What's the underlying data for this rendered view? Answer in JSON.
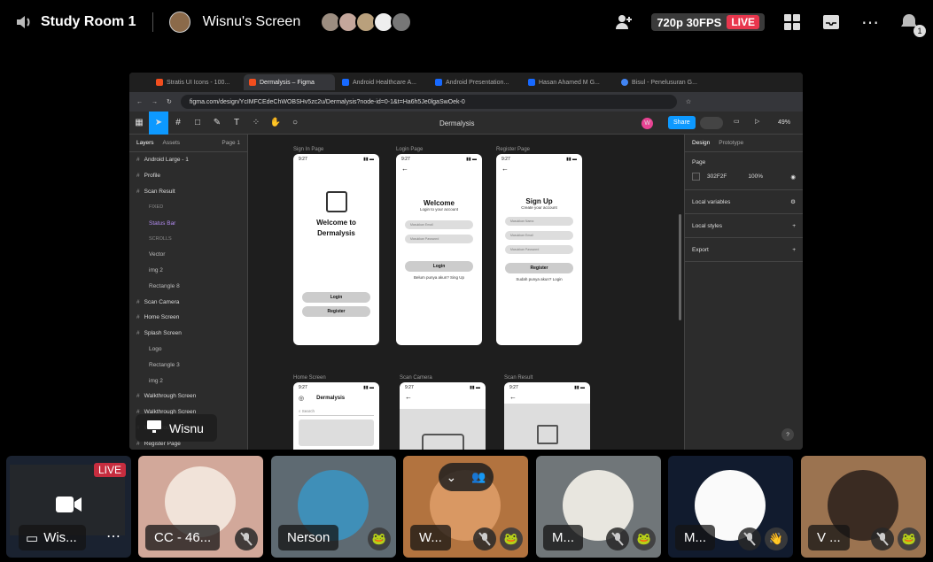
{
  "topbar": {
    "room_title": "Study Room 1",
    "screen_owner": "Wisnu's Screen",
    "quality": "720p 30FPS",
    "live": "LIVE",
    "notification_count": "1"
  },
  "browser": {
    "tabs": [
      {
        "label": "Stratis UI Icons - 100...",
        "color": "#f24e1e"
      },
      {
        "label": "Dermalysis – Figma",
        "color": "#f24e1e"
      },
      {
        "label": "Android Healthcare A...",
        "color": "#1769ff"
      },
      {
        "label": "Android Presentation...",
        "color": "#1769ff"
      },
      {
        "label": "Hasan Ahamed M G...",
        "color": "#1769ff"
      },
      {
        "label": "Bisul - Penelusuran G...",
        "color": "#4285f4"
      }
    ],
    "url": "figma.com/design/YcIMFCEdeChWOBSHv5zc2u/Dermalysis?node-id=0-1&t=Ha6h5Je0lgaSwOek-0"
  },
  "figma": {
    "doc_title": "Dermalysis",
    "share_label": "Share",
    "user_initial": "W",
    "zoom": "49%",
    "layers_tab": "Layers",
    "assets_tab": "Assets",
    "page_label": "Page 1",
    "layers": [
      {
        "label": "Android Large - 1",
        "kind": "frame"
      },
      {
        "label": "Profile",
        "kind": "frame"
      },
      {
        "label": "Scan Result",
        "kind": "frame"
      },
      {
        "label": "FIXED",
        "kind": "head"
      },
      {
        "label": "Status Bar",
        "kind": "purple"
      },
      {
        "label": "SCROLLS",
        "kind": "head"
      },
      {
        "label": "Vector",
        "kind": "sub"
      },
      {
        "label": "img 2",
        "kind": "sub"
      },
      {
        "label": "Rectangle 8",
        "kind": "sub"
      },
      {
        "label": "Scan Camera",
        "kind": "frame"
      },
      {
        "label": "Home Screen",
        "kind": "frame"
      },
      {
        "label": "Splash Screen",
        "kind": "frame"
      },
      {
        "label": "Logo",
        "kind": "sub"
      },
      {
        "label": "Rectangle 3",
        "kind": "sub"
      },
      {
        "label": "img 2",
        "kind": "sub"
      },
      {
        "label": "Walkthrough Screen",
        "kind": "frame"
      },
      {
        "label": "Walkthrough Screen",
        "kind": "frame"
      },
      {
        "label": "Walkthrough Screen",
        "kind": "frame"
      },
      {
        "label": "Register Page",
        "kind": "frame"
      }
    ],
    "right_panel": {
      "design_tab": "Design",
      "prototype_tab": "Prototype",
      "page_heading": "Page",
      "fill_hex": "302F2F",
      "fill_opacity": "100%",
      "local_variables": "Local variables",
      "local_styles": "Local styles",
      "export": "Export",
      "help": "?"
    },
    "frames": {
      "signin": {
        "label": "Sign In Page",
        "time": "9:27",
        "title": "Welcome to Dermalysis",
        "login": "Login",
        "register": "Register"
      },
      "login": {
        "label": "Login Page",
        "time": "9:27",
        "title": "Welcome",
        "subtitle": "Login to your account",
        "email_ph": "Masukkan Email",
        "password_ph": "Masukkan Password",
        "button": "Login",
        "footer": "Belum punya akun? Sing Up"
      },
      "register": {
        "label": "Register Page",
        "time": "9:27",
        "title": "Sign Up",
        "subtitle": "Create your account",
        "name_ph": "Masukkan Nama",
        "email_ph": "Masukkan Email",
        "password_ph": "Masukkan Password",
        "button": "Register",
        "footer": "Sudah punya akun? Login"
      },
      "home": {
        "label": "Home Screen",
        "time": "9:27",
        "title": "Dermalysis",
        "search_ph": "Search"
      },
      "scan_camera": {
        "label": "Scan Camera",
        "time": "9:27"
      },
      "scan_result": {
        "label": "Scan Result",
        "time": "9:27"
      }
    }
  },
  "presenter_tag": "Wisnu",
  "participants": [
    {
      "name": "Wis...",
      "live": "LIVE"
    },
    {
      "name": "CC - 46..."
    },
    {
      "name": "Nerson"
    },
    {
      "name": "W..."
    },
    {
      "name": "M..."
    },
    {
      "name": "M..."
    },
    {
      "name": "V ..."
    }
  ]
}
